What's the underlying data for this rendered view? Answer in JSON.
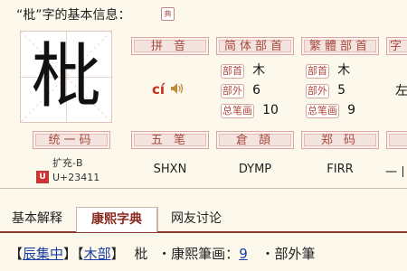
{
  "title": "“枇”字的基本信息：",
  "title_icon": "dictionary-stamp-icon",
  "big_char": "枇",
  "headers": {
    "pinyin": "拼 音",
    "simplified_radical": "简体部首",
    "traditional_radical": "繁體部首",
    "partial": "字",
    "unified_code": "统一码",
    "wubi": "五 笔",
    "cangjie": "倉 頡",
    "zhengma": "郑 码"
  },
  "pinyin": "cí",
  "speaker_icon": "speaker-icon",
  "simplified": {
    "radical_tag": "部首",
    "radical_val": "木",
    "outside_tag": "部外",
    "outside_val": "6",
    "total_tag": "总笔画",
    "total_val": "10"
  },
  "traditional": {
    "radical_tag": "部首",
    "radical_val": "木",
    "outside_tag": "部外",
    "outside_val": "5",
    "total_tag": "总笔画",
    "total_val": "9"
  },
  "partial_value": "左",
  "unicode": {
    "block": "扩充-B",
    "code": "U+23411"
  },
  "wubi": "SHXN",
  "cangjie": "DYMP",
  "zhengma": "FIRR",
  "partial_bottom": "一丨",
  "tabs": [
    "基本解释",
    "康熙字典",
    "网友讨论"
  ],
  "footer": {
    "open1": "【",
    "link1": "辰集中",
    "close1": "】",
    "open2": "【",
    "link2": "木部",
    "close2": "】",
    "char": "枇",
    "bullet1": "・康熙筆画：",
    "strokes": "9",
    "bullet2": "・部外筆"
  }
}
